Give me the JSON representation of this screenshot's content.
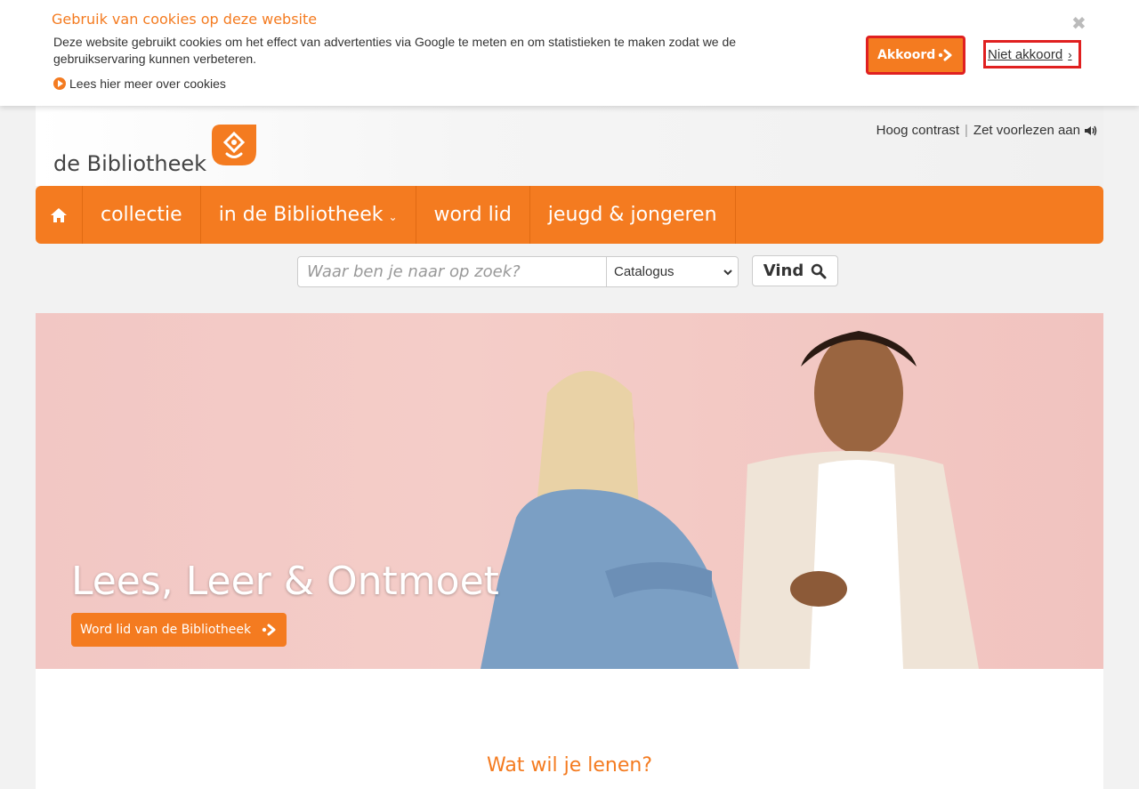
{
  "cookie": {
    "title": "Gebruik van cookies op deze website",
    "text": "Deze website gebruikt cookies om het effect van advertenties via Google te meten en om statistieken te maken zodat we de gebruikservaring kunnen verbeteren.",
    "more_link": "Lees hier meer over cookies",
    "accept_label": "Akkoord",
    "decline_label": "Niet akkoord",
    "close_glyph": "✖"
  },
  "header": {
    "logo_text": "de Bibliotheek",
    "high_contrast": "Hoog contrast",
    "read_aloud": "Zet voorlezen aan"
  },
  "nav": {
    "items": [
      {
        "label": "collectie"
      },
      {
        "label": "in de Bibliotheek"
      },
      {
        "label": "word lid"
      },
      {
        "label": "jeugd & jongeren"
      }
    ]
  },
  "search": {
    "placeholder": "Waar ben je naar op zoek?",
    "scope_selected": "Catalogus",
    "button_label": "Vind"
  },
  "hero": {
    "title": "Lees, Leer & Ontmoet",
    "cta_label": "Word lid van de Bibliotheek"
  },
  "section": {
    "title": "Wat wil je lenen?"
  },
  "colors": {
    "accent": "#f47b20",
    "highlight_border": "#e02020"
  },
  "icons": [
    "play-icon",
    "arrow-dots-icon",
    "chevron-right-icon",
    "close-icon",
    "logo-icon",
    "speaker-icon",
    "home-icon",
    "chevron-down-icon",
    "search-icon"
  ]
}
